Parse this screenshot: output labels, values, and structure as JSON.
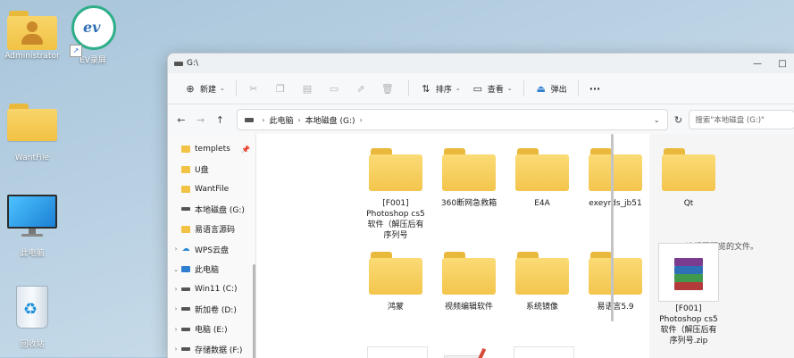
{
  "desktop": {
    "icons": [
      {
        "label": "Administrator"
      },
      {
        "label": "EV录屏"
      },
      {
        "label": "WantFile"
      },
      {
        "label": "此电脑"
      },
      {
        "label": "回收站"
      }
    ]
  },
  "window": {
    "title": "G:\\",
    "controls": {
      "minimize": "—",
      "maximize": "□"
    }
  },
  "toolbar": {
    "new_label": "新建",
    "sort_label": "排序",
    "view_label": "查看",
    "eject_label": "弹出",
    "more_label": "···"
  },
  "address": {
    "crumbs": [
      "此电脑",
      "本地磁盘 (G:)"
    ],
    "search_placeholder": "搜索\"本地磁盘 (G:)\""
  },
  "sidebar": {
    "items": [
      {
        "label": "templets",
        "icon": "folder",
        "pinned": true
      },
      {
        "label": "U盘",
        "icon": "folder"
      },
      {
        "label": "WantFile",
        "icon": "folder"
      },
      {
        "label": "本地磁盘 (G:)",
        "icon": "drive"
      },
      {
        "label": "易语言源码",
        "icon": "folder"
      },
      {
        "label": "WPS云盘",
        "icon": "cloud"
      },
      {
        "label": "此电脑",
        "icon": "pc"
      },
      {
        "label": "Win11 (C:)",
        "icon": "drive"
      },
      {
        "label": "新加卷 (D:)",
        "icon": "drive"
      },
      {
        "label": "电脑 (E:)",
        "icon": "drive"
      },
      {
        "label": "存储数据 (F:)",
        "icon": "drive"
      }
    ]
  },
  "files": [
    {
      "name": "[F001]\nPhotoshop cs5\n软件（解压后有\n序列号",
      "type": "folder"
    },
    {
      "name": "360断网急救箱",
      "type": "folder"
    },
    {
      "name": "E4A",
      "type": "folder"
    },
    {
      "name": "exeyrds_jb51",
      "type": "folder"
    },
    {
      "name": "Qt",
      "type": "folder"
    },
    {
      "name": "鸿蒙",
      "type": "folder"
    },
    {
      "name": "视频编辑软件",
      "type": "folder"
    },
    {
      "name": "系统镜像",
      "type": "folder"
    },
    {
      "name": "易语言5.9",
      "type": "folder"
    },
    {
      "name": "[F001]\nPhotoshop cs5\n软件（解压后有\n序列号.zip",
      "type": "archive"
    }
  ],
  "preview": {
    "empty_text": "选择要预览的文件。"
  },
  "colors": {
    "folder": "#f3c54d",
    "accent": "#2e7fd0"
  }
}
